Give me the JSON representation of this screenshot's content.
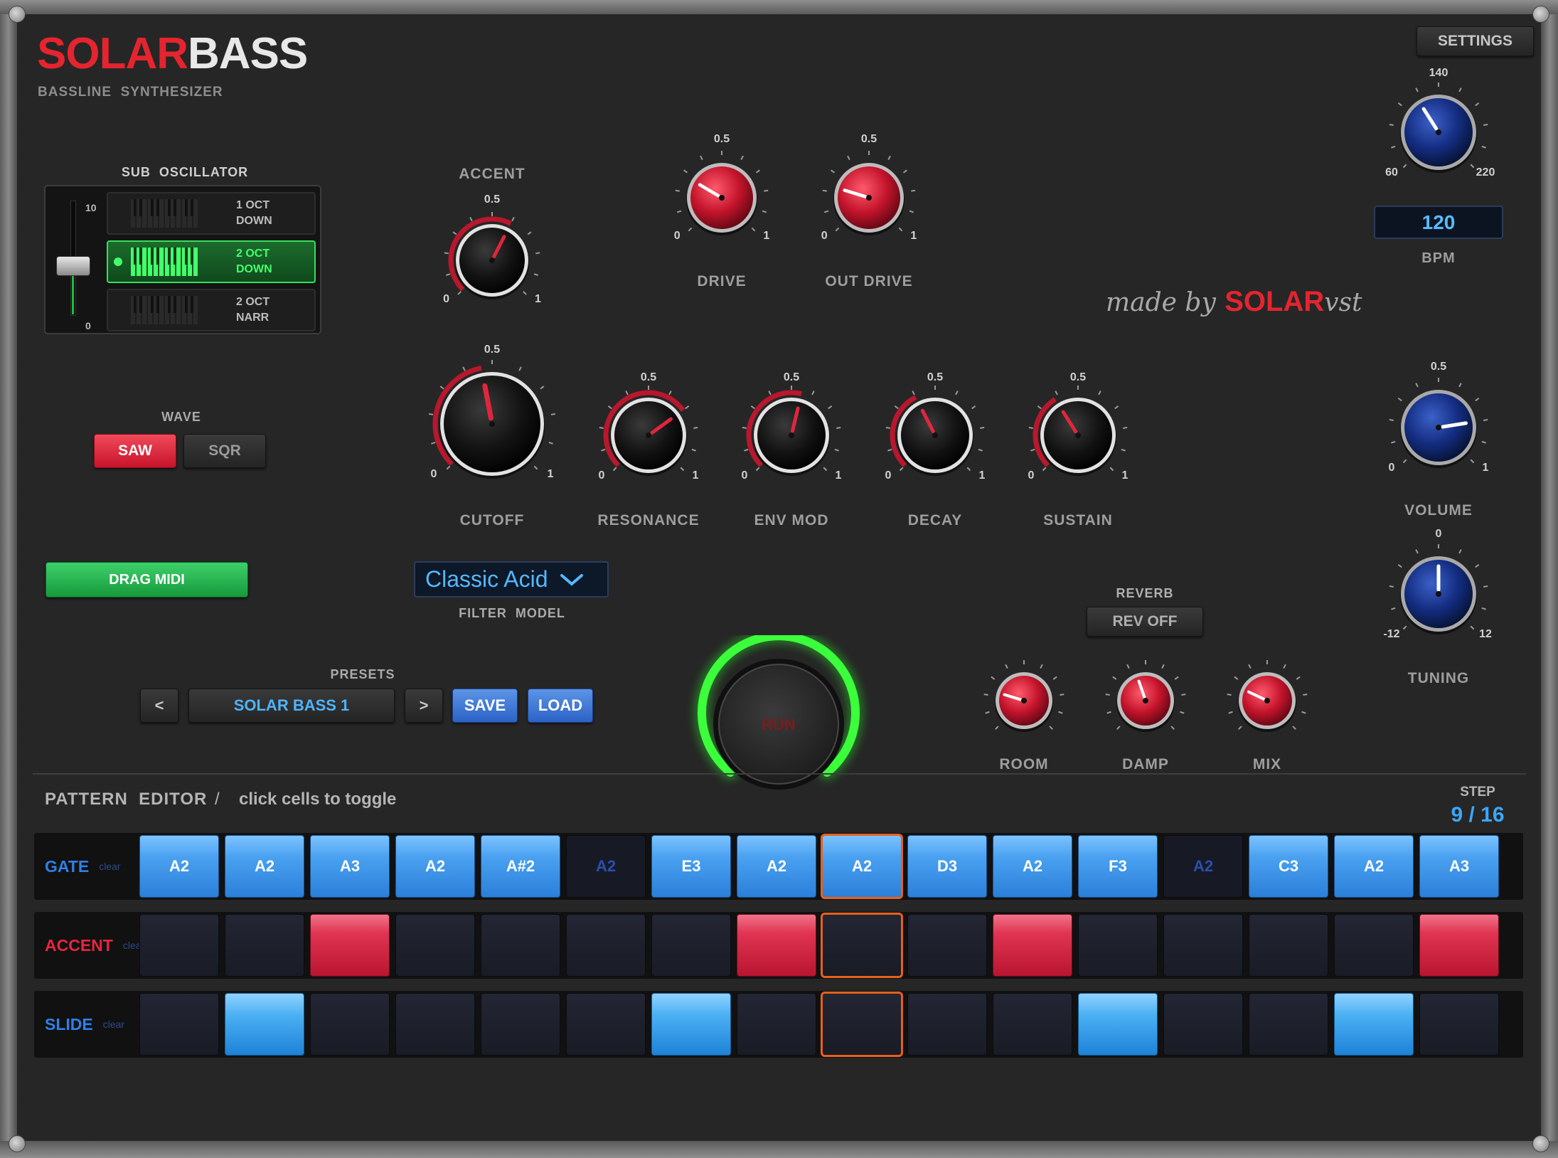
{
  "brand": {
    "solar": "SOLAR",
    "bass": "BASS",
    "subtitle": "BASSLINE  SYNTHESIZER",
    "made_by": "made by",
    "made_solar": "SOLAR",
    "made_vst": "vst"
  },
  "settings_label": "SETTINGS",
  "tempo": {
    "bpm_value": "120",
    "bpm_label": "BPM",
    "min": "60",
    "max": "220",
    "top": "140"
  },
  "sub_oscillator": {
    "title": "SUB  OSCILLATOR",
    "slider_top": "10",
    "slider_bottom": "0",
    "options": [
      {
        "line1": "1 OCT",
        "line2": "DOWN",
        "selected": false
      },
      {
        "line1": "2 OCT",
        "line2": "DOWN",
        "selected": true
      },
      {
        "line1": "2 OCT",
        "line2": "NARR",
        "selected": false
      }
    ]
  },
  "wave": {
    "title": "WAVE",
    "saw": "SAW",
    "sqr": "SQR",
    "selected": "SAW"
  },
  "drag_midi": "DRAG MIDI",
  "filter_model": {
    "value": "Classic Acid",
    "label": "FILTER  MODEL"
  },
  "presets": {
    "title": "PRESETS",
    "prev": "<",
    "next": ">",
    "name": "SOLAR BASS 1",
    "save": "SAVE",
    "load": "LOAD"
  },
  "run_label": "RUN",
  "reverb": {
    "title": "REVERB",
    "mode": "REV OFF"
  },
  "knobs": {
    "accent": {
      "label": "ACCENT",
      "mid": "0.5",
      "min": "0",
      "max": "1",
      "value": 0.6
    },
    "drive": {
      "label": "DRIVE",
      "mid": "0.5",
      "min": "0",
      "max": "1",
      "value": 0.28
    },
    "out_drive": {
      "label": "OUT DRIVE",
      "mid": "0.5",
      "min": "0",
      "max": "1",
      "value": 0.23
    },
    "cutoff": {
      "label": "CUTOFF",
      "mid": "0.5",
      "min": "0",
      "max": "1",
      "value": 0.46
    },
    "resonance": {
      "label": "RESONANCE",
      "mid": "0.5",
      "min": "0",
      "max": "1",
      "value": 0.7
    },
    "env_mod": {
      "label": "ENV MOD",
      "mid": "0.5",
      "min": "0",
      "max": "1",
      "value": 0.55
    },
    "decay": {
      "label": "DECAY",
      "mid": "0.5",
      "min": "0",
      "max": "1",
      "value": 0.4
    },
    "sustain": {
      "label": "SUSTAIN",
      "mid": "0.5",
      "min": "0",
      "max": "1",
      "value": 0.38
    },
    "volume": {
      "label": "VOLUME",
      "mid": "0.5",
      "min": "0",
      "max": "1",
      "value": 0.8
    },
    "tuning": {
      "label": "TUNING",
      "mid": "0",
      "min": "-12",
      "max": "12",
      "value": 0.5
    },
    "bpm": {
      "label": "",
      "mid": "140",
      "min": "60",
      "max": "220",
      "value": 0.38
    },
    "room": {
      "label": "ROOM",
      "mid": "",
      "min": "",
      "max": "",
      "value": 0.23
    },
    "damp": {
      "label": "DAMP",
      "mid": "",
      "min": "",
      "max": "",
      "value": 0.43
    },
    "mix": {
      "label": "MIX",
      "mid": "",
      "min": "",
      "max": "",
      "value": 0.26
    }
  },
  "pattern": {
    "title": "PATTERN  EDITOR",
    "sep": "/",
    "hint": "click cells to toggle",
    "step_label": "STEP",
    "step_value": "9 / 16",
    "current_step": 9,
    "rows": [
      {
        "name": "GATE",
        "clear": "clear",
        "color": "#2f7fe8"
      },
      {
        "name": "ACCENT",
        "clear": "clear",
        "color": "#e8253e"
      },
      {
        "name": "SLIDE",
        "clear": "clear",
        "color": "#2f7fe8"
      }
    ],
    "gate": [
      {
        "note": "A2",
        "on": true
      },
      {
        "note": "A2",
        "on": true
      },
      {
        "note": "A3",
        "on": true
      },
      {
        "note": "A2",
        "on": true
      },
      {
        "note": "A#2",
        "on": true
      },
      {
        "note": "A2",
        "on": false
      },
      {
        "note": "E3",
        "on": true
      },
      {
        "note": "A2",
        "on": true
      },
      {
        "note": "A2",
        "on": true
      },
      {
        "note": "D3",
        "on": true
      },
      {
        "note": "A2",
        "on": true
      },
      {
        "note": "F3",
        "on": true
      },
      {
        "note": "A2",
        "on": false
      },
      {
        "note": "C3",
        "on": true
      },
      {
        "note": "A2",
        "on": true
      },
      {
        "note": "A3",
        "on": true
      }
    ],
    "accent": [
      false,
      false,
      true,
      false,
      false,
      false,
      false,
      true,
      false,
      false,
      true,
      false,
      false,
      false,
      false,
      true
    ],
    "slide": [
      false,
      true,
      false,
      false,
      false,
      false,
      true,
      false,
      false,
      false,
      false,
      true,
      false,
      false,
      true,
      false
    ]
  },
  "colors": {
    "brand_red": "#e4242f",
    "accent_blue": "#3aa7ff",
    "run_green": "#3cff3c"
  }
}
